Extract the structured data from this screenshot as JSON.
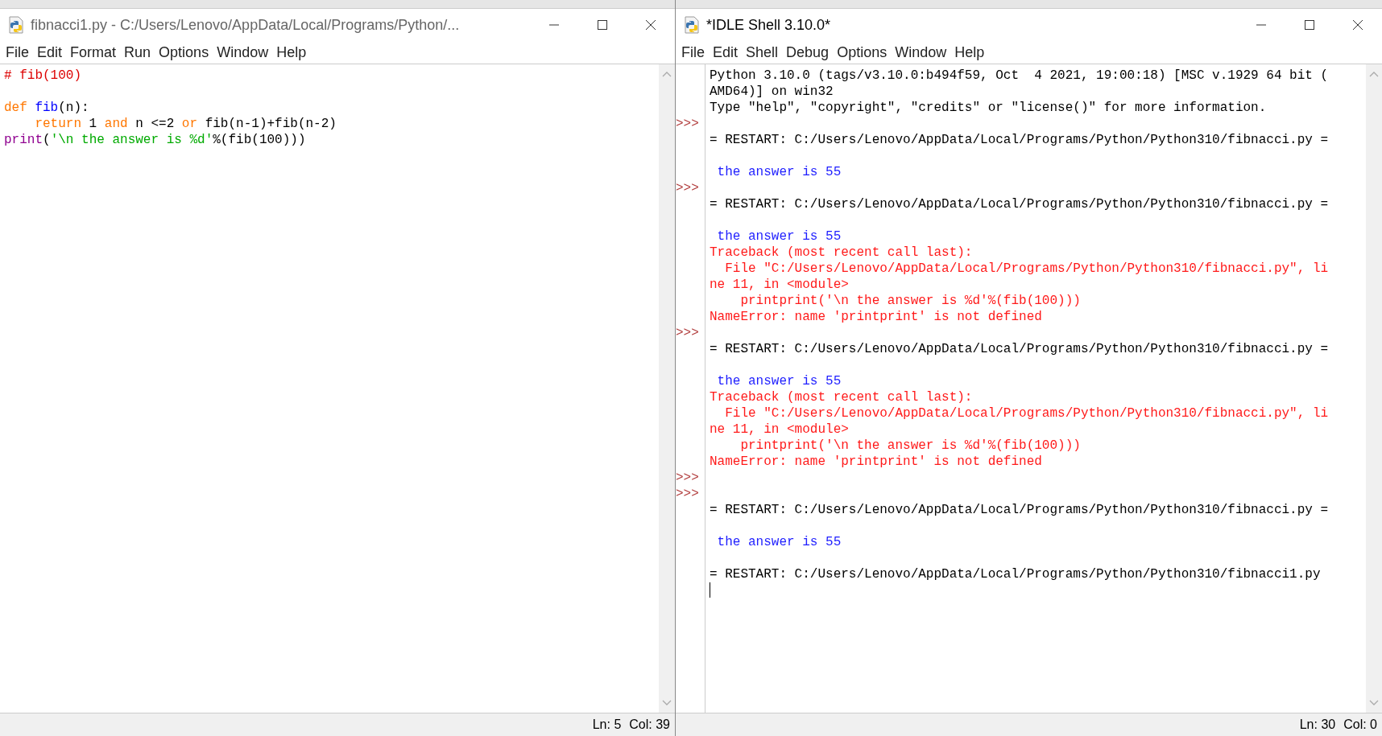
{
  "editor_window": {
    "title": "fibnacci1.py - C:/Users/Lenovo/AppData/Local/Programs/Python/...",
    "active": false,
    "menu": [
      "File",
      "Edit",
      "Format",
      "Run",
      "Options",
      "Window",
      "Help"
    ],
    "lines": [
      {
        "kind": "code",
        "tokens": [
          {
            "text": "# fib(100)",
            "kind": "comment"
          }
        ]
      },
      {
        "kind": "blank"
      },
      {
        "kind": "code",
        "tokens": [
          {
            "text": "def ",
            "kind": "keyword"
          },
          {
            "text": "fib",
            "kind": "definition"
          },
          {
            "text": "(n):",
            "kind": "plain"
          }
        ]
      },
      {
        "kind": "code",
        "tokens": [
          {
            "text": "    return",
            "kind": "keyword"
          },
          {
            "text": " 1 ",
            "kind": "plain"
          },
          {
            "text": "and",
            "kind": "keyword"
          },
          {
            "text": " n <=2 ",
            "kind": "plain"
          },
          {
            "text": "or",
            "kind": "keyword"
          },
          {
            "text": " fib(n-1)+fib(n-2)",
            "kind": "plain"
          }
        ]
      },
      {
        "kind": "code",
        "tokens": [
          {
            "text": "print",
            "kind": "builtin"
          },
          {
            "text": "(",
            "kind": "plain"
          },
          {
            "text": "'\\n the answer is %d'",
            "kind": "string"
          },
          {
            "text": "%(fib(100)))",
            "kind": "plain"
          }
        ]
      }
    ],
    "status": {
      "line": "Ln: 5",
      "col": "Col: 39"
    }
  },
  "shell_window": {
    "title": "*IDLE Shell 3.10.0*",
    "active": true,
    "menu": [
      "File",
      "Edit",
      "Shell",
      "Debug",
      "Options",
      "Window",
      "Help"
    ],
    "lines": [
      {
        "kind": "output",
        "text": "Python 3.10.0 (tags/v3.10.0:b494f59, Oct  4 2021, 19:00:18) [MSC v.1929 64 bit ("
      },
      {
        "kind": "output",
        "text": "AMD64)] on win32"
      },
      {
        "kind": "output",
        "text": "Type \"help\", \"copyright\", \"credits\" or \"license()\" for more information."
      },
      {
        "kind": "blank",
        "prompt": ">>>"
      },
      {
        "kind": "output",
        "text": "= RESTART: C:/Users/Lenovo/AppData/Local/Programs/Python/Python310/fibnacci.py ="
      },
      {
        "kind": "blank"
      },
      {
        "kind": "stdout",
        "text": " the answer is 55"
      },
      {
        "kind": "blank",
        "prompt": ">>>"
      },
      {
        "kind": "output",
        "text": "= RESTART: C:/Users/Lenovo/AppData/Local/Programs/Python/Python310/fibnacci.py ="
      },
      {
        "kind": "blank"
      },
      {
        "kind": "stdout",
        "text": " the answer is 55"
      },
      {
        "kind": "error",
        "text": "Traceback (most recent call last):"
      },
      {
        "kind": "error",
        "text": "  File \"C:/Users/Lenovo/AppData/Local/Programs/Python/Python310/fibnacci.py\", li"
      },
      {
        "kind": "error",
        "text": "ne 11, in <module>"
      },
      {
        "kind": "error",
        "text": "    printprint('\\n the answer is %d'%(fib(100)))"
      },
      {
        "kind": "error",
        "text": "NameError: name 'printprint' is not defined"
      },
      {
        "kind": "blank",
        "prompt": ">>>"
      },
      {
        "kind": "output",
        "text": "= RESTART: C:/Users/Lenovo/AppData/Local/Programs/Python/Python310/fibnacci.py ="
      },
      {
        "kind": "blank"
      },
      {
        "kind": "stdout",
        "text": " the answer is 55"
      },
      {
        "kind": "error",
        "text": "Traceback (most recent call last):"
      },
      {
        "kind": "error",
        "text": "  File \"C:/Users/Lenovo/AppData/Local/Programs/Python/Python310/fibnacci.py\", li"
      },
      {
        "kind": "error",
        "text": "ne 11, in <module>"
      },
      {
        "kind": "error",
        "text": "    printprint('\\n the answer is %d'%(fib(100)))"
      },
      {
        "kind": "error",
        "text": "NameError: name 'printprint' is not defined"
      },
      {
        "kind": "blank",
        "prompt": ">>>"
      },
      {
        "kind": "blank",
        "prompt": ">>>"
      },
      {
        "kind": "output",
        "text": "= RESTART: C:/Users/Lenovo/AppData/Local/Programs/Python/Python310/fibnacci.py ="
      },
      {
        "kind": "blank"
      },
      {
        "kind": "stdout",
        "text": " the answer is 55"
      },
      {
        "kind": "blank"
      },
      {
        "kind": "output",
        "text": "= RESTART: C:/Users/Lenovo/AppData/Local/Programs/Python/Python310/fibnacci1.py"
      },
      {
        "kind": "cursor"
      }
    ],
    "status": {
      "line": "Ln: 30",
      "col": "Col: 0"
    }
  }
}
